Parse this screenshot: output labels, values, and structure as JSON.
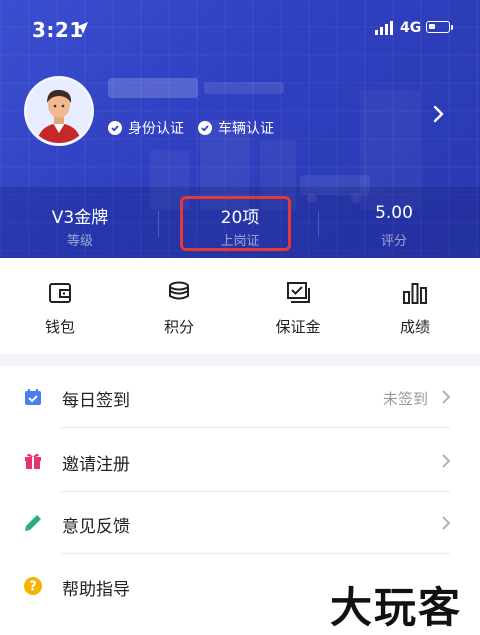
{
  "status_bar": {
    "time": "3:21",
    "network": "4G"
  },
  "profile": {
    "badges": [
      {
        "label": "身份认证"
      },
      {
        "label": "车辆认证"
      }
    ]
  },
  "stats": [
    {
      "value": "V3金牌",
      "label": "等级"
    },
    {
      "value": "20项",
      "label": "上岗证"
    },
    {
      "value": "5.00",
      "label": "评分"
    }
  ],
  "actions": [
    {
      "label": "钱包",
      "icon": "wallet-icon"
    },
    {
      "label": "积分",
      "icon": "coins-icon"
    },
    {
      "label": "保证金",
      "icon": "deposit-icon"
    },
    {
      "label": "成绩",
      "icon": "bar-chart-icon"
    }
  ],
  "list": [
    {
      "title": "每日签到",
      "value": "未签到",
      "icon": "calendar-icon",
      "icon_color": "#4a7ef0"
    },
    {
      "title": "邀请注册",
      "value": "",
      "icon": "gift-icon",
      "icon_color": "#e8336f"
    },
    {
      "title": "意见反馈",
      "value": "",
      "icon": "pencil-icon",
      "icon_color": "#26b07a"
    },
    {
      "title": "帮助指导",
      "value": "",
      "icon": "help-icon",
      "icon_color": "#f5b300"
    }
  ],
  "watermark": "大玩客",
  "colors": {
    "header_blue": "#2f3fbf",
    "highlight_red": "#e53935"
  }
}
